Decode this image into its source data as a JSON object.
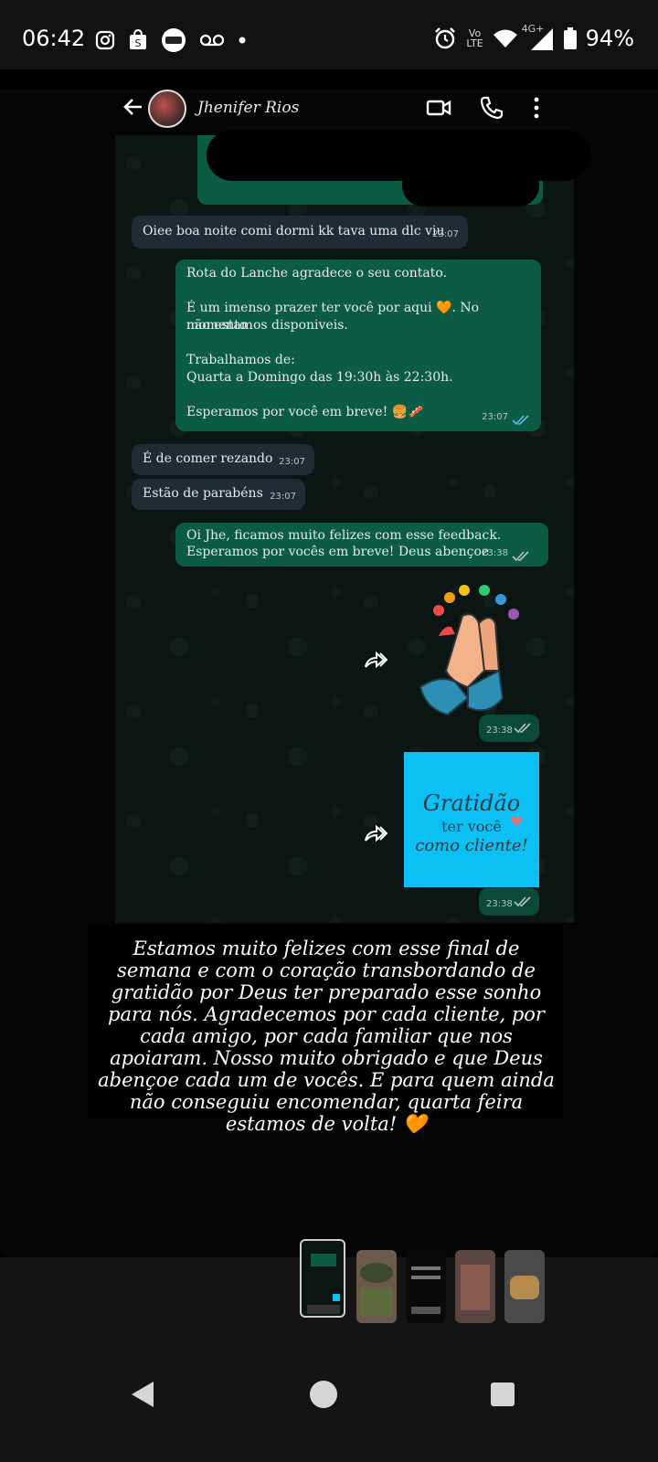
{
  "status_bar": {
    "time": "06:42",
    "left_icons": [
      "instagram-icon",
      "shopee-icon",
      "app-badge-icon",
      "voicemail-icon",
      "dot-icon"
    ],
    "lte_label_top": "Vo",
    "lte_label_bottom": "LTE",
    "network": "4G+",
    "battery": "94%",
    "right_icons": [
      "alarm-icon",
      "volte-icon",
      "wifi-icon",
      "signal-icon",
      "battery-icon"
    ]
  },
  "chat": {
    "contact_name": "Jhenifer Rios",
    "messages": [
      {
        "dir": "in",
        "text": "Oiee boa noite comi dormi kk tava uma dlc viu",
        "time": "23:07"
      },
      {
        "dir": "out",
        "lines": [
          "Rota do Lanche agradece o seu contato.",
          "",
          "É um imenso prazer ter você por aqui 🧡. No momento",
          "não estamos disponiveis.",
          "",
          "Trabalhamos de:",
          "Quarta a Domingo das 19:30h às 22:30h.",
          "",
          "Esperamos por você em breve! 🍔🥓"
        ],
        "time": "23:07"
      },
      {
        "dir": "in",
        "text": "É  de comer rezando",
        "time": "23:07"
      },
      {
        "dir": "in",
        "text": "Estão de parabéns",
        "time": "23:07"
      },
      {
        "dir": "out",
        "lines": [
          "Oi Jhe, ficamos muito felizes com esse feedback.",
          "Esperamos por vocês em breve! Deus abençoe"
        ],
        "time": "23:38"
      },
      {
        "dir": "out",
        "type": "sticker",
        "time": "23:38"
      },
      {
        "dir": "out",
        "type": "image",
        "time": "23:38"
      }
    ],
    "image_text": {
      "line1": "Gratidão",
      "line2": "ter você",
      "line3": "como cliente!"
    }
  },
  "caption": "Estamos muito felizes com esse final de semana e com o coração transbordando de gratidão por Deus ter preparado esse sonho para nós. Agradecemos por cada cliente, por cada amigo, por cada familiar que nos apoiaram. Nosso muito obrigado e que Deus abençoe cada um de vocês. E para quem ainda não conseguiu encomendar, quarta feira estamos de volta! 🧡",
  "thumbnails": [
    "thumb-chat-active",
    "thumb-food",
    "thumb-text",
    "thumb-photo",
    "thumb-sandwich"
  ],
  "colors": {
    "outgoing": "#0b5b45",
    "incoming": "#202c33",
    "image_bg": "#0ac0f4",
    "read_ticks": "#53bdeb"
  }
}
